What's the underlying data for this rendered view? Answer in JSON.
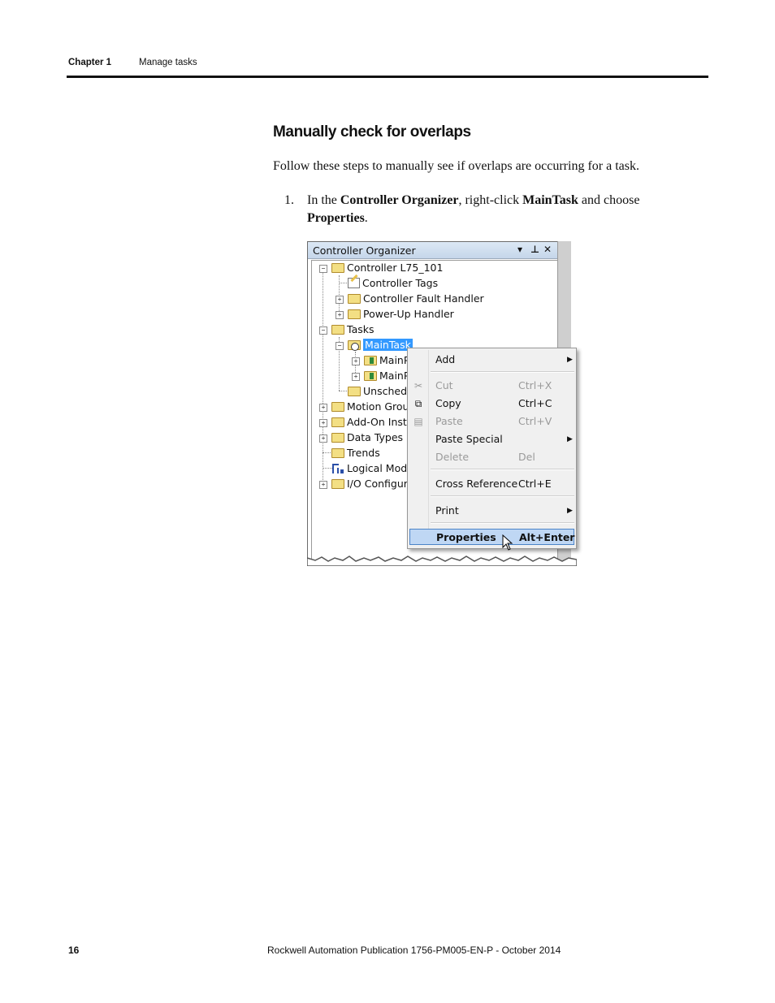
{
  "header": {
    "chapter": "Chapter 1",
    "title": "Manage tasks"
  },
  "section": {
    "title": "Manually check for overlaps",
    "intro": "Follow these steps to manually see if overlaps are occurring for a task."
  },
  "steps": [
    {
      "number": "1.",
      "text_pre": "In the ",
      "bold1": "Controller Organizer",
      "text_mid": ", right-click ",
      "bold2": "MainTask",
      "text_mid2": " and choose ",
      "bold3": "Properties",
      "text_end": "."
    }
  ],
  "organizer": {
    "title": "Controller Organizer",
    "buttons": {
      "dropdown": "▾",
      "pin": "⊥",
      "close": "✕"
    },
    "tree": [
      {
        "label": "Controller L75_101",
        "icon": "folder-icon"
      },
      {
        "label": "Controller Tags",
        "icon": "tags-icon"
      },
      {
        "label": "Controller Fault Handler",
        "icon": "folder-icon"
      },
      {
        "label": "Power-Up Handler",
        "icon": "folder-icon"
      },
      {
        "label": "Tasks",
        "icon": "folder-icon"
      },
      {
        "label": "MainTask",
        "icon": "task-icon"
      },
      {
        "label": "MainP",
        "icon": "program-icon"
      },
      {
        "label": "MainP",
        "icon": "program-icon"
      },
      {
        "label": "Unschedu",
        "icon": "folder-icon"
      },
      {
        "label": "Motion Group",
        "icon": "folder-icon"
      },
      {
        "label": "Add-On Instru",
        "icon": "folder-icon"
      },
      {
        "label": "Data Types",
        "icon": "folder-icon"
      },
      {
        "label": "Trends",
        "icon": "folder-icon"
      },
      {
        "label": "Logical Mode",
        "icon": "logical-model-icon"
      },
      {
        "label": "I/O Configura",
        "icon": "folder-icon"
      }
    ]
  },
  "context_menu": {
    "items": [
      {
        "label": "Add",
        "shortcut": "",
        "submenu": true,
        "disabled": false
      },
      {
        "label": "Cut",
        "shortcut": "Ctrl+X",
        "submenu": false,
        "disabled": true
      },
      {
        "label": "Copy",
        "shortcut": "Ctrl+C",
        "submenu": false,
        "disabled": false
      },
      {
        "label": "Paste",
        "shortcut": "Ctrl+V",
        "submenu": false,
        "disabled": true
      },
      {
        "label": "Paste Special",
        "shortcut": "",
        "submenu": true,
        "disabled": false
      },
      {
        "label": "Delete",
        "shortcut": "Del",
        "submenu": false,
        "disabled": true
      },
      {
        "label": "Cross Reference",
        "shortcut": "Ctrl+E",
        "submenu": false,
        "disabled": false
      },
      {
        "label": "Print",
        "shortcut": "",
        "submenu": true,
        "disabled": false
      },
      {
        "label": "Properties",
        "shortcut": "Alt+Enter",
        "submenu": false,
        "disabled": false,
        "highlighted": true
      }
    ]
  },
  "footer": {
    "page_number": "16",
    "publication": "Rockwell Automation Publication 1756-PM005-EN-P - October 2014"
  }
}
